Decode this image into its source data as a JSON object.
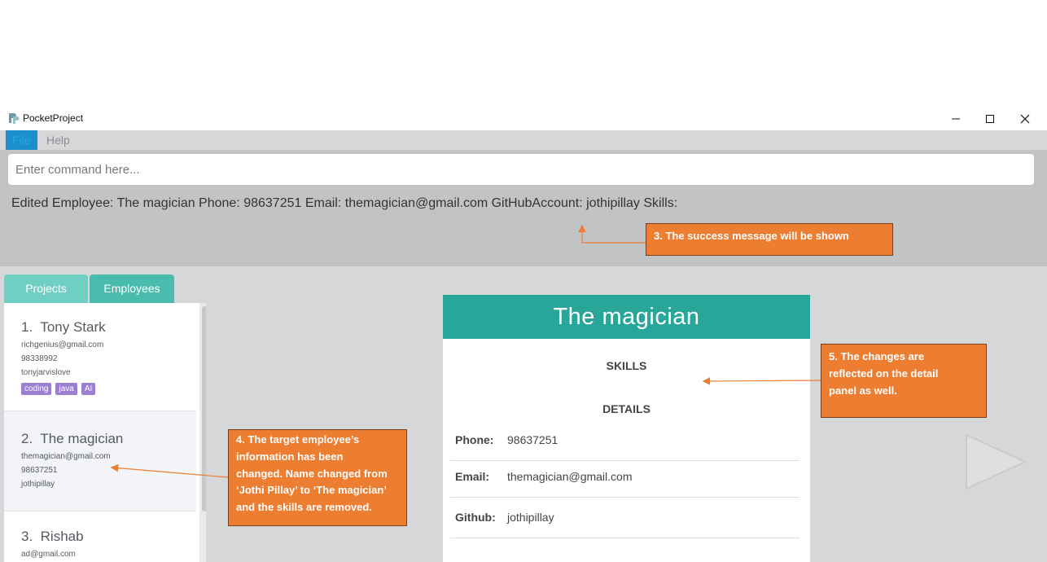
{
  "window": {
    "title": "PocketProject"
  },
  "menu": {
    "items": [
      "File",
      "Help"
    ]
  },
  "command": {
    "placeholder": "Enter command here..."
  },
  "result_message": "Edited Employee: The magician Phone: 98637251 Email: themagician@gmail.com GitHubAccount: jothipillay Skills:",
  "tabs": [
    "Projects",
    "Employees"
  ],
  "employees": [
    {
      "index": "1.",
      "name": "Tony Stark",
      "email": "richgenius@gmail.com",
      "phone": "98338992",
      "github": "tonyjarvislove",
      "skills": [
        "coding",
        "java",
        "AI"
      ]
    },
    {
      "index": "2.",
      "name": "The magician",
      "email": "themagician@gmail.com",
      "phone": "98637251",
      "github": "jothipillay",
      "skills": []
    },
    {
      "index": "3.",
      "name": "Rishab",
      "email": "ad@gmail.com"
    }
  ],
  "detail": {
    "name": "The magician",
    "skills_heading": "SKILLS",
    "details_heading": "DETAILS",
    "rows": [
      {
        "label": "Phone:",
        "value": "98637251"
      },
      {
        "label": "Email:",
        "value": "themagician@gmail.com"
      },
      {
        "label": "Github:",
        "value": "jothipillay"
      }
    ]
  },
  "annotations": {
    "note3": [
      "3. The success message will be shown"
    ],
    "note4": [
      "4. The target employee’s",
      "information has been",
      "changed. Name changed from",
      "‘Jothi Pillay’ to ‘The magician’",
      "and the skills are removed."
    ],
    "note5": [
      "5. The changes are",
      "reflected on the detail",
      "panel as well."
    ]
  },
  "colors": {
    "header_teal": "#27a699",
    "tab_projects": "#6fcfc3",
    "tab_employees": "#49bcae",
    "tag_purple": "#9b7fd1",
    "annotation_orange": "#ed7d31",
    "menu_active": "#1b8ecb"
  },
  "icons": [
    "app-logo-icon",
    "minimize-icon",
    "maximize-icon",
    "close-icon",
    "play-icon"
  ]
}
